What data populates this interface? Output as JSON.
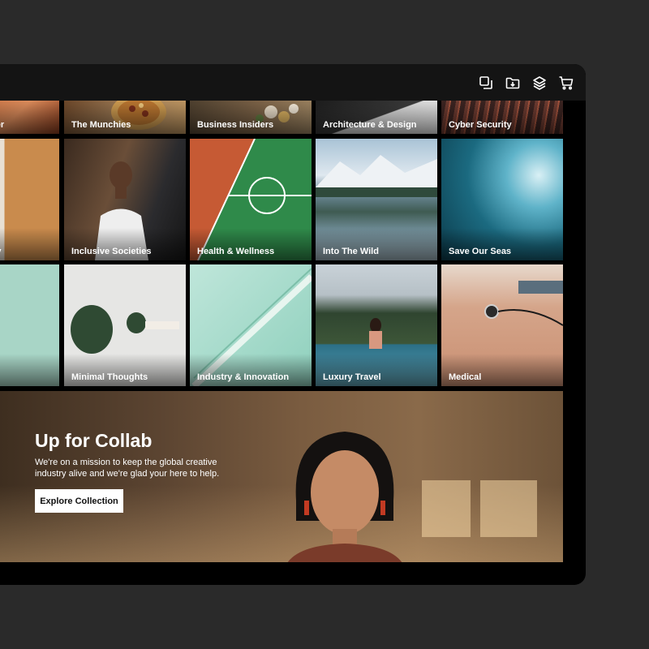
{
  "toolbar": {
    "icons": [
      "copy-icon",
      "folder-download-icon",
      "layers-icon",
      "cart-icon"
    ]
  },
  "collections": {
    "row1": [
      {
        "label": "ater"
      },
      {
        "label": "The Munchies"
      },
      {
        "label": "Business Insiders"
      },
      {
        "label": "Architecture & Design"
      },
      {
        "label": "Cyber Security"
      }
    ],
    "row2": [
      {
        "label": "uty"
      },
      {
        "label": "Inclusive Societies"
      },
      {
        "label": "Health & Wellness"
      },
      {
        "label": "Into The Wild"
      },
      {
        "label": "Save Our Seas"
      }
    ],
    "row3": [
      {
        "label": ""
      },
      {
        "label": "Minimal Thoughts"
      },
      {
        "label": "Industry & Innovation"
      },
      {
        "label": "Luxury Travel"
      },
      {
        "label": "Medical"
      }
    ]
  },
  "banner": {
    "title": "Up for Collab",
    "text": "We're on a mission to keep the global creative industry alive and we're glad your here to help.",
    "button_label": "Explore Collection"
  },
  "colors": {
    "page_background": "#2a2a2a",
    "device_background": "#000000",
    "topbar_background": "#141414",
    "button_background": "#ffffff"
  }
}
